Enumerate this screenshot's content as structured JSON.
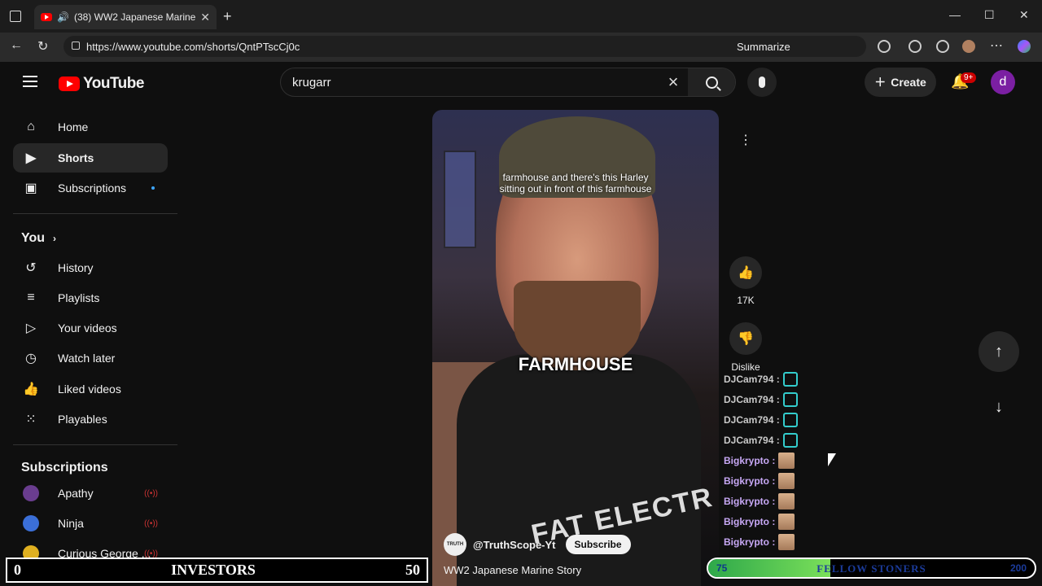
{
  "browser": {
    "tab_title": "(38) WW2 Japanese Marine",
    "url": "https://www.youtube.com/shorts/QntPTscCj0c",
    "summarize_label": "Summarize"
  },
  "header": {
    "logo_text": "YouTube",
    "search_value": "krugarr",
    "create_label": "Create",
    "notif_badge": "9+",
    "avatar_letter": "d"
  },
  "sidebar": {
    "main": [
      {
        "label": "Home",
        "icon": "home-icon"
      },
      {
        "label": "Shorts",
        "icon": "shorts-icon"
      },
      {
        "label": "Subscriptions",
        "icon": "subscriptions-icon"
      }
    ],
    "you_heading": "You",
    "you": [
      {
        "label": "History",
        "icon": "history-icon"
      },
      {
        "label": "Playlists",
        "icon": "playlists-icon"
      },
      {
        "label": "Your videos",
        "icon": "your-videos-icon"
      },
      {
        "label": "Watch later",
        "icon": "watch-later-icon"
      },
      {
        "label": "Liked videos",
        "icon": "liked-videos-icon"
      },
      {
        "label": "Playables",
        "icon": "playables-icon"
      }
    ],
    "subs_heading": "Subscriptions",
    "subs": [
      {
        "label": "Apathy",
        "color": "#6a3d8f"
      },
      {
        "label": "Ninja",
        "color": "#3b6fd8"
      },
      {
        "label": "Curious George ...",
        "color": "#e0b020"
      }
    ]
  },
  "video": {
    "subtitle_line1": "farmhouse and there's this Harley",
    "subtitle_line2": "sitting out in front of this farmhouse",
    "caption": "FARMHOUSE",
    "shirt_text": "FAT ELECTR",
    "channel": "@TruthScope-Yt",
    "channel_avatar_text": "TRUTH",
    "subscribe_label": "Subscribe",
    "title": "WW2 Japanese Marine Story"
  },
  "actions": {
    "likes": "17K",
    "dislike_label": "Dislike"
  },
  "chat": [
    {
      "user": "DJCam794 :",
      "style": "n1"
    },
    {
      "user": "DJCam794 :",
      "style": "n1"
    },
    {
      "user": "DJCam794 :",
      "style": "n1"
    },
    {
      "user": "DJCam794 :",
      "style": "n1"
    },
    {
      "user": "Bigkrypto :",
      "style": "n2"
    },
    {
      "user": "Bigkrypto :",
      "style": "n2"
    },
    {
      "user": "Bigkrypto :",
      "style": "n2"
    },
    {
      "user": "Bigkrypto :",
      "style": "n2"
    },
    {
      "user": "Bigkrypto :",
      "style": "n2"
    }
  ],
  "overlays": {
    "investors_left": "0",
    "investors_label": "INVESTORS",
    "investors_right": "50",
    "stoners_level": "75",
    "stoners_label": "FELLOW STONERS",
    "stoners_max": "200",
    "stoners_fraction": 0.375
  }
}
